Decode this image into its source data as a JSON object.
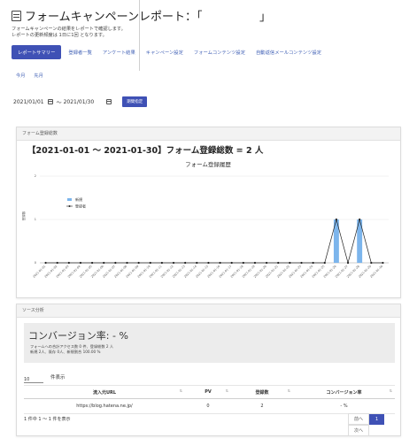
{
  "header": {
    "title": "フォームキャンペーンレポート：「",
    "title_tail": "」",
    "desc_line1": "フォームキャンペーンの結果をレポートで確認します。",
    "desc_line2": "レポートの更新頻度は 1日に1回 となります。"
  },
  "tabs": [
    {
      "label": "レポートサマリー"
    },
    {
      "label": "登録者一覧"
    },
    {
      "label": "アンケート結果"
    },
    {
      "label": "キャンペーン設定"
    },
    {
      "label": "フォームコンテンツ設定"
    },
    {
      "label": "自動返信メールコンテンツ設定"
    }
  ],
  "period_links": {
    "this_month": "今月",
    "last_month": "先月"
  },
  "date_range": {
    "from": "2021/01/01",
    "separator": "～",
    "to": "2021/01/30",
    "submit": "期間指定"
  },
  "registration_card": {
    "header": "フォーム登録総数",
    "summary": "【2021-01-01 ～ 2021-01-30】フォーム登録総数 = 2 人"
  },
  "chart_data": {
    "type": "line",
    "title": "フォーム登録履歴",
    "ylabel": "登録数",
    "ylim": [
      0,
      2
    ],
    "yticks": [
      0,
      1,
      2
    ],
    "x": [
      "2021-01-01",
      "2021-01-02",
      "2021-01-03",
      "2021-01-04",
      "2021-01-05",
      "2021-01-06",
      "2021-01-07",
      "2021-01-08",
      "2021-01-09",
      "2021-01-10",
      "2021-01-11",
      "2021-01-12",
      "2021-01-13",
      "2021-01-14",
      "2021-01-15",
      "2021-01-16",
      "2021-01-17",
      "2021-01-18",
      "2021-01-19",
      "2021-01-20",
      "2021-01-21",
      "2021-01-22",
      "2021-01-23",
      "2021-01-24",
      "2021-01-25",
      "2021-01-26",
      "2021-01-27",
      "2021-01-28",
      "2021-01-29",
      "2021-01-30"
    ],
    "series": [
      {
        "name": "新規",
        "type": "bar",
        "color": "#7cb5ec",
        "values": [
          0,
          0,
          0,
          0,
          0,
          0,
          0,
          0,
          0,
          0,
          0,
          0,
          0,
          0,
          0,
          0,
          0,
          0,
          0,
          0,
          0,
          0,
          0,
          0,
          0,
          1,
          0,
          1,
          0,
          0
        ]
      },
      {
        "name": "登録者",
        "type": "line",
        "color": "#222222",
        "values": [
          0,
          0,
          0,
          0,
          0,
          0,
          0,
          0,
          0,
          0,
          0,
          0,
          0,
          0,
          0,
          0,
          0,
          0,
          0,
          0,
          0,
          0,
          0,
          0,
          0,
          1,
          0,
          1,
          0,
          0
        ]
      }
    ],
    "legend": "top-left"
  },
  "source_card": {
    "header": "ソース分析",
    "conversion_title": "コンバージョン率: - %",
    "stats_line1": "フォームへの合計アクセス数 0 件、登録総数 2 人",
    "stats_line2": "新規 2人、既存 0人、新規割合 100.00 %",
    "page_length": "10",
    "page_length_suffix": "件表示",
    "table": {
      "columns": [
        "流入元URL",
        "PV",
        "登録数",
        "コンバージョン率"
      ],
      "rows": [
        [
          "https://blog.hatena.ne.jp/",
          "0",
          "2",
          "- %"
        ]
      ]
    },
    "info": "1 件中 1 ～ 1 件を表示",
    "pagination": {
      "prev": "前へ",
      "current": "1",
      "next": "次へ"
    }
  }
}
